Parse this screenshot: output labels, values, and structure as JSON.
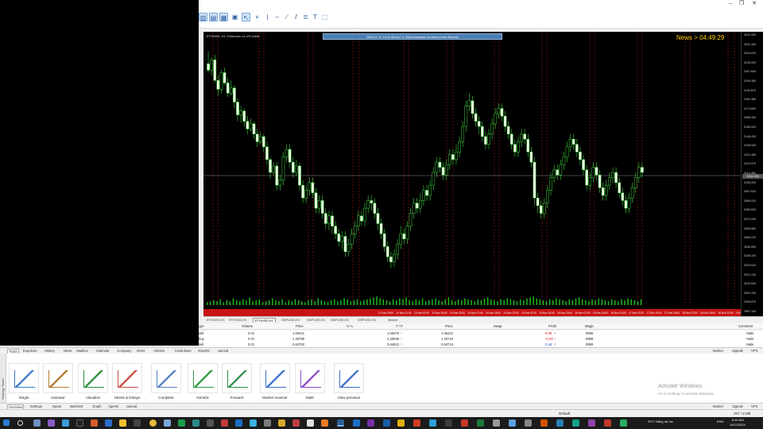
{
  "chart": {
    "symbol_caption": "ETHUSD, H1:  Ethereum vs US Dollar",
    "banner": "2024.11.17 13:10:00 AU: 2, RBA Assistant Governor Kent Speech",
    "news_countdown": "News > 04:49:29",
    "candles": [
      [
        245,
        240,
        255,
        238
      ],
      [
        240,
        248,
        250,
        236
      ],
      [
        248,
        232,
        252,
        230
      ],
      [
        232,
        225,
        236,
        220
      ],
      [
        225,
        238,
        240,
        222
      ],
      [
        238,
        230,
        242,
        228
      ],
      [
        230,
        222,
        234,
        219
      ],
      [
        222,
        226,
        232,
        220
      ],
      [
        226,
        215,
        228,
        210
      ],
      [
        215,
        205,
        218,
        200
      ],
      [
        205,
        208,
        212,
        199
      ],
      [
        208,
        200,
        210,
        196
      ],
      [
        200,
        194,
        204,
        190
      ],
      [
        194,
        198,
        202,
        192
      ],
      [
        198,
        190,
        200,
        186
      ],
      [
        190,
        184,
        194,
        180
      ],
      [
        184,
        188,
        192,
        182
      ],
      [
        188,
        180,
        190,
        176
      ],
      [
        180,
        170,
        184,
        166
      ],
      [
        170,
        160,
        172,
        155
      ],
      [
        160,
        165,
        168,
        158
      ],
      [
        165,
        150,
        168,
        146
      ],
      [
        150,
        154,
        158,
        146
      ],
      [
        154,
        172,
        176,
        150
      ],
      [
        172,
        178,
        182,
        168
      ],
      [
        178,
        168,
        182,
        164
      ],
      [
        168,
        160,
        172,
        156
      ],
      [
        160,
        165,
        170,
        157
      ],
      [
        165,
        150,
        168,
        146
      ],
      [
        150,
        140,
        154,
        136
      ],
      [
        140,
        146,
        150,
        136
      ],
      [
        146,
        152,
        156,
        142
      ],
      [
        152,
        144,
        156,
        140
      ],
      [
        144,
        132,
        148,
        128
      ],
      [
        132,
        138,
        142,
        128
      ],
      [
        138,
        128,
        142,
        124
      ],
      [
        128,
        120,
        132,
        116
      ],
      [
        120,
        126,
        130,
        115
      ],
      [
        126,
        118,
        130,
        112
      ],
      [
        118,
        112,
        122,
        108
      ],
      [
        112,
        106,
        116,
        102
      ],
      [
        106,
        110,
        114,
        100
      ],
      [
        110,
        98,
        114,
        94
      ],
      [
        98,
        104,
        108,
        94
      ],
      [
        104,
        112,
        116,
        100
      ],
      [
        112,
        118,
        122,
        108
      ],
      [
        118,
        126,
        130,
        114
      ],
      [
        126,
        122,
        130,
        118
      ],
      [
        122,
        132,
        136,
        118
      ],
      [
        132,
        138,
        142,
        128
      ],
      [
        138,
        136,
        142,
        130
      ],
      [
        136,
        128,
        140,
        124
      ],
      [
        128,
        120,
        132,
        115
      ],
      [
        120,
        112,
        124,
        108
      ],
      [
        112,
        102,
        116,
        98
      ],
      [
        102,
        94,
        106,
        90
      ],
      [
        94,
        90,
        98,
        85
      ],
      [
        90,
        96,
        100,
        86
      ],
      [
        96,
        104,
        108,
        92
      ],
      [
        104,
        112,
        118,
        100
      ],
      [
        112,
        108,
        116,
        104
      ],
      [
        108,
        118,
        122,
        104
      ],
      [
        118,
        128,
        132,
        114
      ],
      [
        128,
        136,
        140,
        124
      ],
      [
        136,
        132,
        140,
        128
      ],
      [
        132,
        138,
        144,
        128
      ],
      [
        138,
        146,
        150,
        134
      ],
      [
        146,
        142,
        150,
        138
      ],
      [
        142,
        150,
        154,
        138
      ],
      [
        150,
        160,
        164,
        146
      ],
      [
        160,
        168,
        172,
        156
      ],
      [
        168,
        164,
        172,
        160
      ],
      [
        164,
        158,
        168,
        154
      ],
      [
        158,
        166,
        170,
        154
      ],
      [
        166,
        174,
        178,
        162
      ],
      [
        174,
        170,
        178,
        166
      ],
      [
        170,
        176,
        182,
        166
      ],
      [
        176,
        184,
        188,
        172
      ],
      [
        184,
        196,
        200,
        180
      ],
      [
        196,
        212,
        216,
        192
      ],
      [
        212,
        216,
        222,
        208
      ],
      [
        216,
        206,
        220,
        202
      ],
      [
        206,
        200,
        210,
        196
      ],
      [
        200,
        196,
        204,
        190
      ],
      [
        196,
        188,
        200,
        184
      ],
      [
        188,
        182,
        192,
        178
      ],
      [
        182,
        190,
        194,
        178
      ],
      [
        190,
        198,
        202,
        186
      ],
      [
        198,
        206,
        210,
        194
      ],
      [
        206,
        210,
        214,
        202
      ],
      [
        210,
        204,
        214,
        200
      ],
      [
        204,
        196,
        208,
        192
      ],
      [
        196,
        190,
        200,
        186
      ],
      [
        190,
        182,
        194,
        178
      ],
      [
        182,
        176,
        186,
        172
      ],
      [
        176,
        184,
        188,
        172
      ],
      [
        184,
        190,
        194,
        180
      ],
      [
        190,
        186,
        194,
        182
      ],
      [
        186,
        176,
        190,
        172
      ],
      [
        176,
        168,
        180,
        164
      ],
      [
        168,
        140,
        172,
        134
      ],
      [
        140,
        134,
        144,
        128
      ],
      [
        134,
        128,
        138,
        124
      ],
      [
        128,
        136,
        140,
        124
      ],
      [
        136,
        146,
        150,
        132
      ],
      [
        146,
        156,
        160,
        142
      ],
      [
        156,
        162,
        166,
        152
      ],
      [
        162,
        158,
        166,
        154
      ],
      [
        158,
        166,
        170,
        154
      ],
      [
        166,
        172,
        176,
        162
      ],
      [
        172,
        180,
        184,
        168
      ],
      [
        180,
        186,
        190,
        176
      ],
      [
        186,
        182,
        190,
        178
      ],
      [
        182,
        176,
        186,
        172
      ],
      [
        176,
        170,
        180,
        166
      ],
      [
        170,
        162,
        174,
        158
      ],
      [
        162,
        150,
        166,
        146
      ],
      [
        150,
        156,
        160,
        146
      ],
      [
        156,
        164,
        168,
        152
      ],
      [
        164,
        158,
        168,
        154
      ],
      [
        158,
        148,
        162,
        144
      ],
      [
        148,
        142,
        152,
        138
      ],
      [
        142,
        150,
        154,
        138
      ],
      [
        150,
        156,
        160,
        146
      ],
      [
        156,
        160,
        164,
        152
      ],
      [
        160,
        152,
        164,
        148
      ],
      [
        152,
        144,
        156,
        140
      ],
      [
        144,
        138,
        148,
        134
      ],
      [
        138,
        132,
        142,
        128
      ],
      [
        132,
        140,
        144,
        128
      ],
      [
        140,
        148,
        152,
        136
      ],
      [
        148,
        156,
        160,
        144
      ],
      [
        156,
        164,
        168,
        152
      ],
      [
        164,
        160,
        168,
        156
      ]
    ],
    "vlines_red": [
      12,
      18,
      70,
      76,
      132,
      138,
      188,
      196,
      252,
      258,
      306,
      314,
      366,
      372,
      426,
      432,
      486,
      492,
      546,
      552,
      606,
      612,
      660,
      668
    ],
    "volume": [
      3,
      4,
      5,
      4,
      6,
      3,
      5,
      4,
      7,
      5,
      4,
      6,
      5,
      8,
      4,
      5,
      6,
      3,
      4,
      5,
      7,
      5,
      4,
      6,
      3,
      5,
      4,
      6,
      5,
      4,
      3,
      5,
      6,
      4,
      7,
      5,
      4,
      3,
      5,
      6,
      4,
      5,
      7,
      6,
      4,
      5,
      6,
      4,
      5,
      6,
      7,
      8,
      9,
      7,
      6,
      5,
      4,
      6,
      5,
      7,
      6,
      8,
      5,
      4,
      6,
      5,
      7,
      4,
      5,
      6,
      7,
      5,
      4,
      6,
      8,
      5,
      4,
      6,
      5,
      7,
      6,
      5,
      4,
      6,
      5,
      7,
      8,
      6,
      5,
      4,
      6,
      5,
      7,
      6,
      5,
      4,
      6,
      5,
      7,
      8,
      9,
      7,
      6,
      5,
      4,
      6,
      5,
      7,
      6,
      5,
      4,
      6,
      5,
      7,
      8,
      6,
      5,
      4,
      6,
      5,
      7,
      6,
      5,
      4,
      6,
      5,
      4,
      6,
      5,
      7,
      6,
      5,
      4,
      6
    ],
    "time_labels": [
      "12 Nov 23:00",
      "12 Nov 21:00",
      "13 Nov 07:00",
      "13 Nov 15:00",
      "13 Nov 23:00",
      "14 Nov 07:00",
      "14 Nov 15:00",
      "14 Nov 23:00",
      "15 Nov 07:00",
      "15 Nov 15:00",
      "15 Nov 23:00",
      "16 Nov 07:00",
      "16 Nov 15:00",
      "16 Nov 23:00",
      "17 Nov 07:00",
      "17 Nov 15:00",
      "17 Nov 23:00",
      "18 Nov 07:00",
      "18 Nov 15:00",
      "18 Nov 23:00",
      "19 Nov 07:00",
      "19 Nov 15:00",
      "19 Nov 23:00",
      "20 Nov 07:00"
    ],
    "price_labels": [
      "3241.320",
      "3232.300",
      "3224.810",
      "3216.330",
      "3207.840",
      "3199.350",
      "3190.870",
      "3182.380",
      "3173.890",
      "3165.400",
      "3156.920",
      "3148.430",
      "3139.940",
      "3131.460",
      "3122.970",
      "3114.480",
      "3106.000",
      "3097.510",
      "3089.020",
      "3080.530",
      "3072.050",
      "3063.560",
      "3055.070",
      "3046.590",
      "3038.100",
      "3029.610",
      "3021.130",
      "3012.640",
      "3004.150",
      "2995.670",
      "2987.180"
    ],
    "current_price": "3115.235"
  },
  "chart_tabs": [
    "ETHUSD,H1",
    "ETHUSD,H1",
    "ETHUSD,H1",
    "GBPUSD,H1",
    "GBPUSD,H1",
    "GBPUSD,H1",
    "GBPUSD,H1",
    "Market"
  ],
  "trade": {
    "headers": {
      "type": "ype",
      "volume": "Volume",
      "price": "Price",
      "sl": "S / L",
      "tp": "T / P",
      "price2": "Price",
      "swap": "Swap",
      "profit": "Profit",
      "magic": "Magic",
      "comment": "Comment"
    },
    "rows": [
      {
        "type": "sell",
        "volume": "0.01",
        "price": "1.05421",
        "tp": "1.05276",
        "x": "×",
        "price2": "1.05421",
        "profit": "0.00",
        "magic": "9999",
        "comment": "Haiki"
      },
      {
        "type": "buy",
        "volume": "0.01",
        "price": "1.40785",
        "tp": "1.40935",
        "x": "×",
        "price2": "1.40744",
        "profit": "-0.33",
        "magic": "9999",
        "comment": "Haiki"
      },
      {
        "type": "sell",
        "volume": "0.01",
        "price": "0.64762",
        "tp": "0.64612",
        "x": "×",
        "price2": "0.64714",
        "profit": "0.48",
        "magic": "9999",
        "comment": "Haiki"
      }
    ]
  },
  "toolbox_tabs": [
    "Trade",
    "Exposure",
    "History",
    "News",
    "Mailbox",
    "Calendar",
    "Company",
    "Alerts",
    "Articles",
    "Code Base",
    "Experts",
    "Journal"
  ],
  "toolbox_right": [
    "Market",
    "Signals",
    "VPS"
  ],
  "tester_tools": [
    "Single",
    "Indicator",
    "Visualize",
    "Stress & Delays",
    "Complete",
    "Genetic",
    "Forward",
    "Market scanner",
    "Math",
    "View previous"
  ],
  "side_label": "Strategy Tester",
  "activation": {
    "title": "Activate Windows",
    "subtitle": "Go to Settings to activate Windows."
  },
  "bottom_tabs": [
    "Overview",
    "Settings",
    "Inputs",
    "Backtest",
    "Graph",
    "Agents",
    "Journal"
  ],
  "bottom_right": [
    "Market",
    "Signals",
    "VPS"
  ],
  "status": {
    "profile": "Default",
    "traffic": "207 / 2 Mb"
  },
  "taskbar": {
    "weather": "26°C  Nắng rải rác",
    "lang": "ENG",
    "time": "8:40 AM",
    "date": "18/11/2024"
  }
}
